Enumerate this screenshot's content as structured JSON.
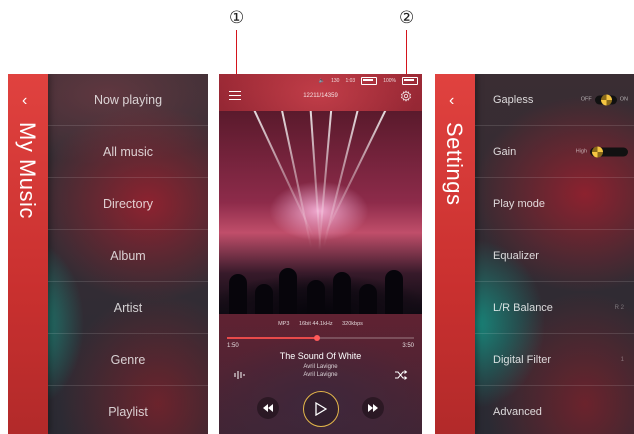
{
  "callouts": [
    "①",
    "②"
  ],
  "left_panel": {
    "back_icon": "chevron-left-icon",
    "title": "My Music",
    "items": [
      "Now playing",
      "All music",
      "Directory",
      "Album",
      "Artist",
      "Genre",
      "Playlist"
    ]
  },
  "player": {
    "status": {
      "volume": "130",
      "time": "1:03",
      "battery": "100%"
    },
    "track_counter": "12211/14359",
    "audio_info": {
      "format": "MP3",
      "quality": "16bit 44.1kHz",
      "bitrate": "320kbps"
    },
    "progress": {
      "elapsed": "1:50",
      "total": "3:50",
      "fraction": 0.48
    },
    "song_title": "The Sound Of White",
    "artist": "Avril Lavigne",
    "album": "Avril Lavigne",
    "accent": "#e84a4a",
    "play_ring": "#e4b74a"
  },
  "right_panel": {
    "back_icon": "chevron-left-icon",
    "title": "Settings",
    "gapless": {
      "label": "Gapless",
      "off": "OFF",
      "on": "ON"
    },
    "gain": {
      "label": "Gain",
      "value": "High"
    },
    "play_mode": {
      "label": "Play mode"
    },
    "equalizer": {
      "label": "Equalizer"
    },
    "balance": {
      "label": "L/R Balance",
      "value": "R 2"
    },
    "digital_filter": {
      "label": "Digital Filter",
      "value": "1"
    },
    "advanced": {
      "label": "Advanced"
    }
  }
}
